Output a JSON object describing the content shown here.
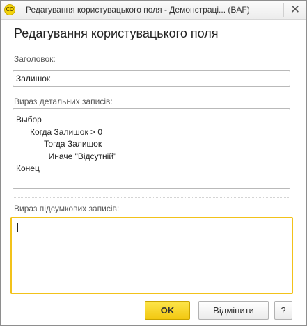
{
  "window": {
    "app_icon_text": "CO",
    "title": "Редагування користувацького поля - Демонстраці...  (BAF)",
    "close_label": "✕"
  },
  "dialog": {
    "heading": "Редагування користувацького поля",
    "title_label": "Заголовок:",
    "title_value": "Залишок",
    "detail_label": "Вираз детальних записів:",
    "detail_lines": [
      "Выбор",
      "      Когда Залишок > 0",
      "            Тогда Залишок",
      "              Иначе \"Відсутній\"",
      "Конец"
    ],
    "summary_label": "Вираз підсумкових записів:",
    "summary_value": ""
  },
  "buttons": {
    "ok": "OK",
    "cancel": "Відмінити",
    "help": "?"
  },
  "colors": {
    "accent_yellow": "#f2c811",
    "focus_border": "#f2c21a"
  }
}
